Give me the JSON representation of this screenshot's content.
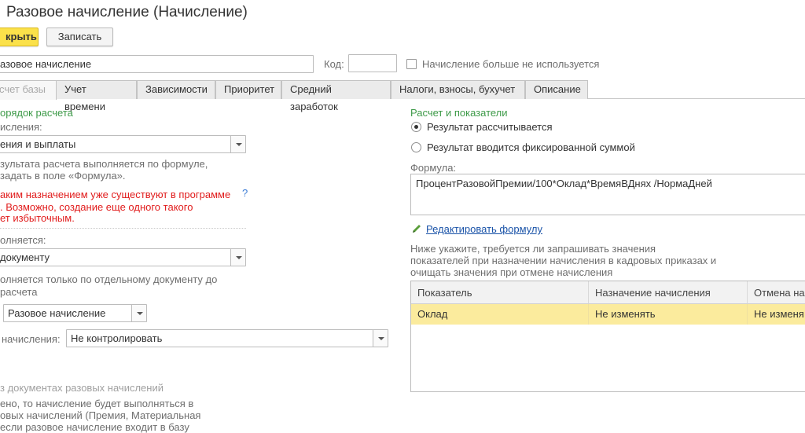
{
  "window": {
    "title": "Разовое начисление (Начисление)"
  },
  "toolbar": {
    "save_close_label": "крыть",
    "save_label": "Записать"
  },
  "header": {
    "name_value": "азовое начисление",
    "code_label": "Код:",
    "code_value": "",
    "not_used_label": "Начисление больше не используется"
  },
  "tabs": [
    {
      "label": "счет базы"
    },
    {
      "label": "Учет времени"
    },
    {
      "label": "Зависимости"
    },
    {
      "label": "Приоритет"
    },
    {
      "label": "Средний заработок"
    },
    {
      "label": "Налоги, взносы, бухучет"
    },
    {
      "label": "Описание"
    }
  ],
  "left": {
    "section_title": "орядок расчета",
    "category_label": "исления:",
    "category_value": "ения и выплаты",
    "info_line1": "зультата расчета выполняется по формуле,",
    "info_line2": "задать в поле «Формула».",
    "warning_line1": "аким назначением уже существуют в программе",
    "warning_line2": ". Возможно, создание еще одного такого",
    "warning_line3": "ет избыточным.",
    "help": "?",
    "performed_label": "олняется:",
    "performed_value": "документу",
    "note_line1": "олняется только по отдельному документу до",
    "note_line2": "расчета",
    "doc_value": "Разовое начисление",
    "control_label": "начисления:",
    "control_value": "Не контролировать",
    "footer_title": "з документах разовых начислений",
    "footer_line1": "ено, то начисление будет выполняться в",
    "footer_line2": "овых начислений (Премия, Материальная",
    "footer_line3": "если разовое начисление входит в базу"
  },
  "right": {
    "section_title": "Расчет и показатели",
    "radio_calc_label": "Результат рассчитывается",
    "radio_fixed_label": "Результат вводится фиксированной суммой",
    "formula_label": "Формула:",
    "formula_value": "ПроцентРазовойПремии/100*Оклад*ВремяВДнях /НормаДней",
    "edit_formula_link": "Редактировать формулу",
    "hint_line1": "Ниже укажите, требуется ли запрашивать значения",
    "hint_line2": "показателей при назначении начисления в кадровых приказах и",
    "hint_line3": "очищать значения при отмене начисления",
    "table": {
      "headers": [
        "Показатель",
        "Назначение начисления",
        "Отмена на"
      ],
      "rows": [
        {
          "indicator": "Оклад",
          "assign": "Не изменять",
          "cancel": "Не изменя"
        }
      ]
    }
  },
  "colors": {
    "accent_button": "#fbe14a",
    "section_title": "#3d9a48",
    "warning": "#e11c1c",
    "selected_row": "#fbeb9d",
    "link": "#1a53a8"
  }
}
